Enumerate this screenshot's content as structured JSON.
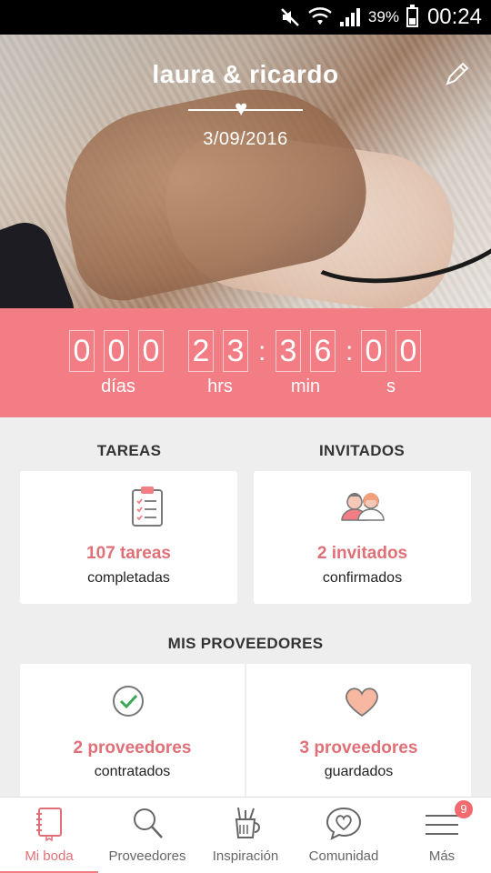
{
  "status_bar": {
    "battery": "39%",
    "time": "00:24",
    "icons": [
      "mute-icon",
      "wifi-icon",
      "signal-icon",
      "battery-icon"
    ]
  },
  "hero": {
    "couple": "laura & ricardo",
    "date": "3/09/2016",
    "edit_icon": "pencil-icon"
  },
  "countdown": {
    "days_digits": [
      "0",
      "0",
      "0"
    ],
    "hours_digits": [
      "2",
      "3"
    ],
    "minutes_digits": [
      "3",
      "6"
    ],
    "seconds_digits": [
      "0",
      "0"
    ],
    "separator": ":",
    "labels": {
      "days": "días",
      "hours": "hrs",
      "minutes": "min",
      "seconds": "s"
    }
  },
  "tareas": {
    "title": "TAREAS",
    "value": "107 tareas",
    "sub": "completadas",
    "icon": "clipboard-checklist-icon"
  },
  "invitados": {
    "title": "INVITADOS",
    "value": "2 invitados",
    "sub": "confirmados",
    "icon": "guests-icon"
  },
  "proveedores": {
    "title": "MIS PROVEEDORES",
    "hired": {
      "value": "2 proveedores",
      "sub": "contratados",
      "icon": "checkmark-circle-icon"
    },
    "saved": {
      "value": "3 proveedores",
      "sub": "guardados",
      "icon": "heart-icon"
    }
  },
  "nav": {
    "items": [
      {
        "label": "Mi boda",
        "icon": "notebook-icon",
        "active": true
      },
      {
        "label": "Proveedores",
        "icon": "search-icon"
      },
      {
        "label": "Inspiración",
        "icon": "pencil-cup-icon"
      },
      {
        "label": "Comunidad",
        "icon": "chat-heart-icon"
      },
      {
        "label": "Más",
        "icon": "menu-icon",
        "badge": "9"
      }
    ]
  },
  "colors": {
    "accent": "#f27d84",
    "accent_text": "#e07077",
    "background": "#eeeeee"
  }
}
